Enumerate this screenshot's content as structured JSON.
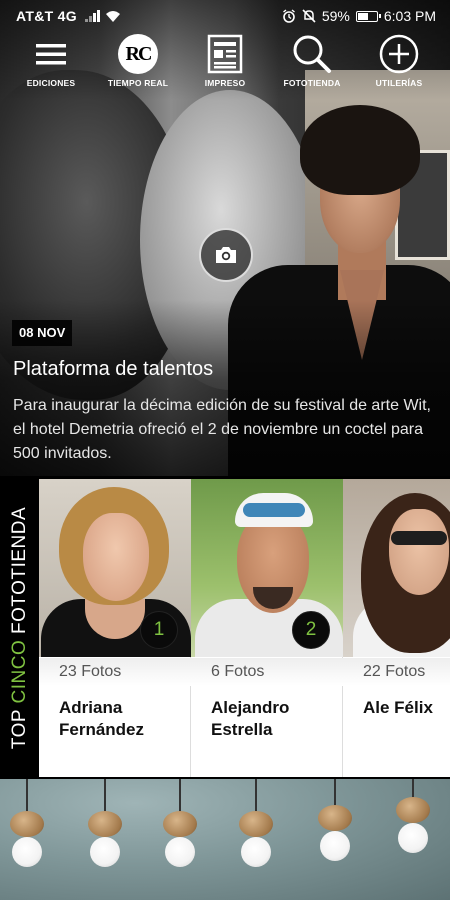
{
  "status_bar": {
    "carrier": "AT&T 4G",
    "battery": "59%",
    "battery_level": 0.59,
    "time": "6:03 PM"
  },
  "nav": [
    {
      "label": "EDICIONES",
      "icon": "hamburger-menu-icon"
    },
    {
      "label": "TIEMPO REAL",
      "icon": "rc-logo-icon"
    },
    {
      "label": "IMPRESO",
      "icon": "newspaper-icon"
    },
    {
      "label": "FOTOTIENDA",
      "icon": "search-icon"
    },
    {
      "label": "UTILERÍAS",
      "icon": "plus-circle-icon"
    }
  ],
  "nav_logo_text": "RC",
  "hero": {
    "date": "08 NOV",
    "title": "Plataforma de talentos",
    "description": "Para inaugurar la décima edición de su festival de arte Wit, el hotel Demetria ofreció el 2 de noviembre un coctel para 500 invitados.",
    "camera_icon": "camera-icon"
  },
  "top_cinco": {
    "label_top": "TOP",
    "label_mid": "CINCO",
    "label_end": "FOTOTIENDA",
    "label_color": "#7fc241",
    "cards": [
      {
        "rank": "1",
        "fotos": "23 Fotos",
        "name": "Adriana Fernández"
      },
      {
        "rank": "2",
        "fotos": "6 Fotos",
        "name": "Alejandro Estrella"
      },
      {
        "rank": "",
        "fotos": "22 Fotos",
        "name": "Ale Félix"
      }
    ]
  }
}
